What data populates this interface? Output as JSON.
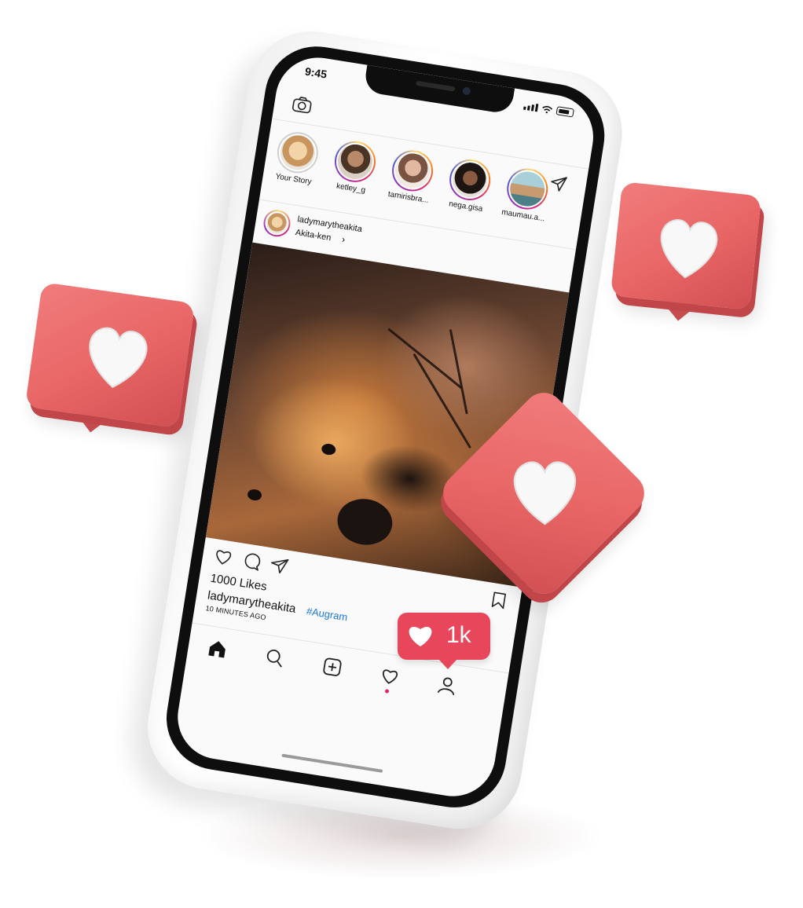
{
  "status_bar": {
    "time": "9:45"
  },
  "stories": [
    {
      "label": "Your Story",
      "own": true,
      "color": "#d9b48f"
    },
    {
      "label": "ketley_g",
      "own": false,
      "color": "#8a6a52"
    },
    {
      "label": "tamirisbra...",
      "own": false,
      "color": "#c89a86"
    },
    {
      "label": "nega.gisa",
      "own": false,
      "color": "#3b2a24"
    },
    {
      "label": "maumau.a...",
      "own": false,
      "color": "#6fa0a8"
    }
  ],
  "post": {
    "username": "ladymarytheakita",
    "location": "Akita-ken",
    "likes": "1000 Likes",
    "caption_user": "ladymarytheakita",
    "hashtag": "#Augram",
    "time_ago": "10 MINUTES AGO"
  },
  "notification": {
    "count": "1k",
    "color": "#e8475b"
  },
  "icons": {
    "camera": "camera-icon",
    "igtv": "igtv-icon",
    "direct": "paper-plane-icon",
    "like": "heart-icon",
    "comment": "comment-icon",
    "share": "paper-plane-icon",
    "save": "bookmark-icon",
    "home": "home-icon",
    "search": "search-icon",
    "add": "add-icon",
    "activity": "heart-icon",
    "profile": "user-icon"
  },
  "colors": {
    "accent": "#e8475b",
    "hashtag": "#1778d6",
    "bubble": "#e86565"
  }
}
